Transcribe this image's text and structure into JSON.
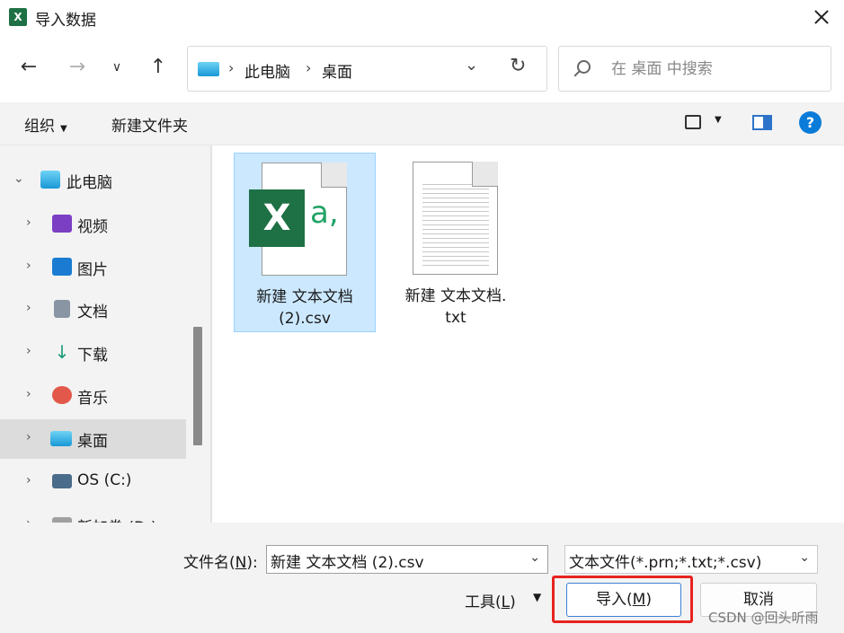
{
  "window": {
    "title": "导入数据",
    "app_icon_letter": "X"
  },
  "nav": {
    "back_icon": "arrow-left-icon",
    "forward_icon": "arrow-right-icon",
    "recent_icon": "chevron-down-icon",
    "up_icon": "arrow-up-icon",
    "breadcrumb": [
      "此电脑",
      "桌面"
    ],
    "breadcrumb_sep": "›",
    "search_placeholder": "在 桌面 中搜索"
  },
  "toolbar": {
    "organize_label": "组织",
    "new_folder_label": "新建文件夹"
  },
  "sidebar": {
    "items": [
      {
        "label": "此电脑",
        "icon": "computer-icon",
        "color": "#1a93d6"
      },
      {
        "label": "视频",
        "icon": "video-icon",
        "color": "#7b3fc4"
      },
      {
        "label": "图片",
        "icon": "picture-icon",
        "color": "#1b7bd2"
      },
      {
        "label": "文档",
        "icon": "document-icon",
        "color": "#8a95a3"
      },
      {
        "label": "下载",
        "icon": "download-icon",
        "color": "#1a9b7a"
      },
      {
        "label": "音乐",
        "icon": "music-icon",
        "color": "#e2584a"
      },
      {
        "label": "桌面",
        "icon": "desktop-icon",
        "color": "#2aa7e3"
      },
      {
        "label": "OS (C:)",
        "icon": "drive-icon",
        "color": "#4a6b8a"
      },
      {
        "label": "新加卷 (D:)",
        "icon": "drive-icon",
        "color": "#a0a0a0"
      }
    ]
  },
  "files": [
    {
      "line1": "新建 文本文档",
      "line2": "(2).csv",
      "icon": "excel-csv-icon",
      "selected": true
    },
    {
      "line1": "新建 文本文档.",
      "line2": "txt",
      "icon": "text-file-icon",
      "selected": false
    }
  ],
  "footer": {
    "filename_label_pre": "文件名(",
    "filename_label_key": "N",
    "filename_label_post": "):",
    "filename_value": "新建 文本文档 (2).csv",
    "filter_value": "文本文件(*.prn;*.txt;*.csv)",
    "tools_pre": "工具(",
    "tools_key": "L",
    "tools_post": ")",
    "import_pre": "导入(",
    "import_key": "M",
    "import_post": ")",
    "cancel_label": "取消",
    "watermark": "CSDN @回头听雨"
  },
  "colors": {
    "accent": "#0a7bd8",
    "highlight": "#e8231f",
    "selection": "#cce8ff",
    "excel_green": "#1e7145"
  }
}
